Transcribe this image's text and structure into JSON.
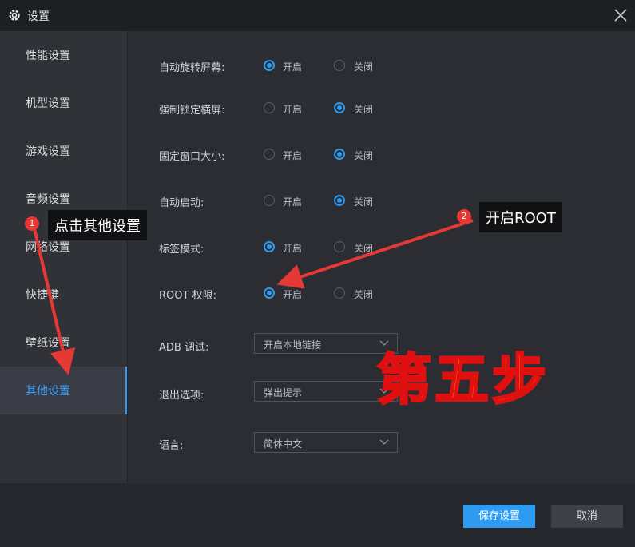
{
  "window": {
    "title": "设置",
    "icon": "gear-icon"
  },
  "sidebar": {
    "items": [
      {
        "label": "性能设置",
        "active": false
      },
      {
        "label": "机型设置",
        "active": false
      },
      {
        "label": "游戏设置",
        "active": false
      },
      {
        "label": "音频设置",
        "active": false
      },
      {
        "label": "网络设置",
        "active": false
      },
      {
        "label": "快捷键",
        "active": false
      },
      {
        "label": "壁纸设置",
        "active": false
      },
      {
        "label": "其他设置",
        "active": true
      }
    ]
  },
  "settings": {
    "on_label": "开启",
    "off_label": "关闭",
    "rows": [
      {
        "label": "自动旋转屏幕:",
        "value": "开启"
      },
      {
        "label": "强制锁定横屏:",
        "value": "关闭"
      },
      {
        "label": "固定窗口大小:",
        "value": "关闭"
      },
      {
        "label": "自动启动:",
        "value": "关闭"
      },
      {
        "label": "标签模式:",
        "value": "开启"
      },
      {
        "label": "ROOT 权限:",
        "value": "开启"
      }
    ],
    "adb": {
      "label": "ADB 调试:",
      "value": "开启本地链接"
    },
    "exit": {
      "label": "退出选项:",
      "value": "弹出提示"
    },
    "language": {
      "label": "语言:",
      "value": "简体中文"
    }
  },
  "footer": {
    "save_label": "保存设置",
    "cancel_label": "取消"
  },
  "annotations": {
    "step1_number": "1",
    "step1_text": "点击其他设置",
    "step2_number": "2",
    "step2_text": "开启ROOT",
    "step_title": "第五步"
  },
  "colors": {
    "accent": "#2f9bf0",
    "arrow": "#e53935",
    "step_fill": "#ffe600",
    "step_stroke": "#e01010"
  }
}
